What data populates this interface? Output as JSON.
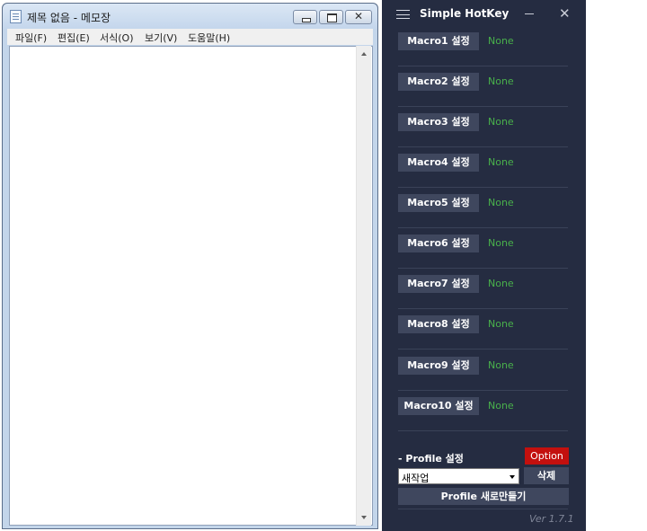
{
  "notepad": {
    "title": "제목 없음 - 메모장",
    "menu": [
      "파일(F)",
      "편집(E)",
      "서식(O)",
      "보기(V)",
      "도움말(H)"
    ],
    "content": ""
  },
  "hotkey": {
    "title": "Simple HotKey",
    "macros": [
      {
        "label": "Macro1 설정",
        "value": "None"
      },
      {
        "label": "Macro2 설정",
        "value": "None"
      },
      {
        "label": "Macro3 설정",
        "value": "None"
      },
      {
        "label": "Macro4 설정",
        "value": "None"
      },
      {
        "label": "Macro5 설정",
        "value": "None"
      },
      {
        "label": "Macro6 설정",
        "value": "None"
      },
      {
        "label": "Macro7 설정",
        "value": "None"
      },
      {
        "label": "Macro8 설정",
        "value": "None"
      },
      {
        "label": "Macro9 설정",
        "value": "None"
      },
      {
        "label": "Macro10 설정",
        "value": "None"
      }
    ],
    "profile_label": "- Profile 설정",
    "option_label": "Option",
    "profile_selected": "새작업",
    "delete_label": "삭제",
    "new_profile_label": "Profile 새로만들기",
    "version": "Ver 1.7.1"
  },
  "colors": {
    "hotkey_bg": "#252c41",
    "button_bg": "#3f475e",
    "value_green": "#49b14b",
    "option_red": "#c3100e"
  }
}
